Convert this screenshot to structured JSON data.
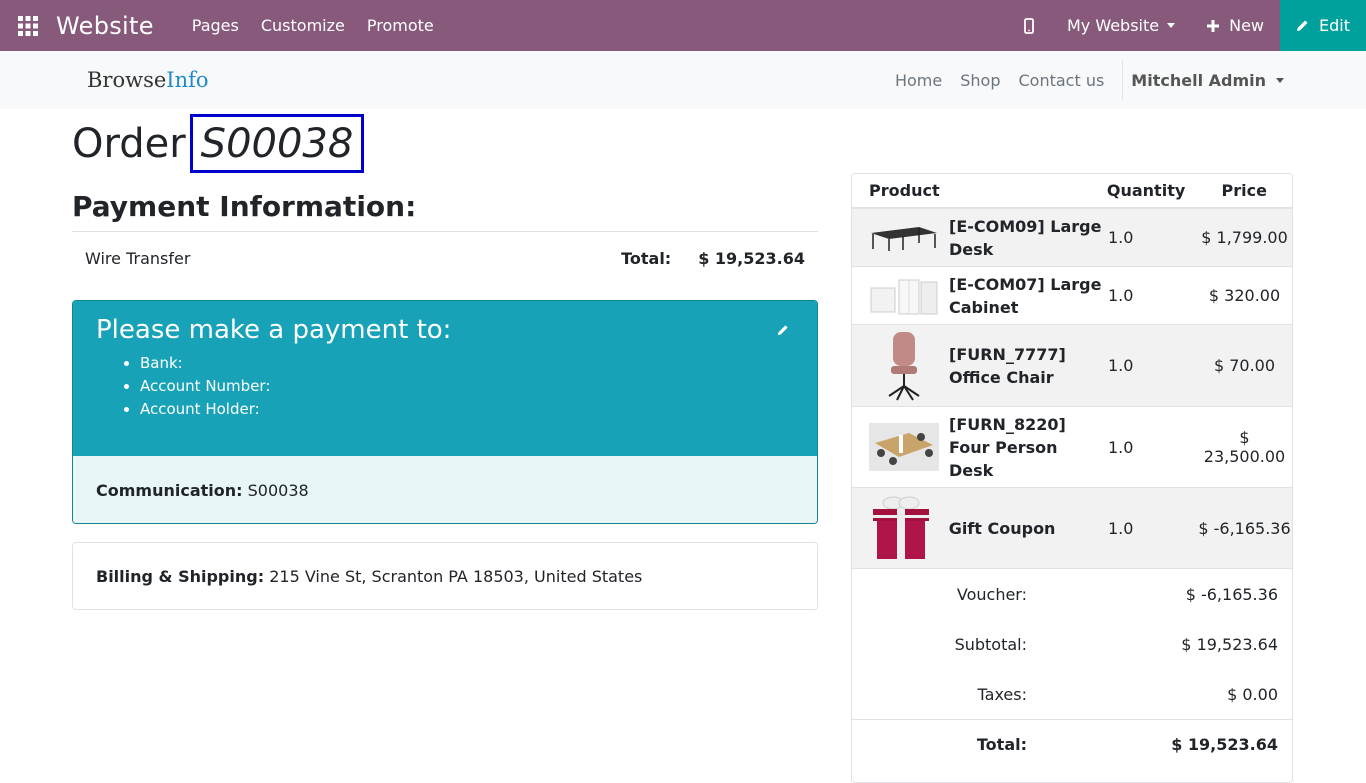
{
  "admin_bar": {
    "brand": "Website",
    "menu": [
      "Pages",
      "Customize",
      "Promote"
    ],
    "site_selector": "My Website",
    "new_label": "New",
    "edit_label": "Edit"
  },
  "site_header": {
    "logo_part1": "Browse",
    "logo_part2": "Info",
    "nav": [
      "Home",
      "Shop",
      "Contact us"
    ],
    "user": "Mitchell Admin"
  },
  "order": {
    "label": "Order",
    "number": "S00038"
  },
  "payment": {
    "heading": "Payment Information:",
    "method": "Wire Transfer",
    "total_label": "Total:",
    "total_value": "$ 19,523.64",
    "instructions_title": "Please make a payment to:",
    "instructions": [
      "Bank:",
      "Account Number:",
      "Account Holder:"
    ],
    "communication_label": "Communication:",
    "communication_value": "S00038"
  },
  "billing": {
    "label": "Billing & Shipping:",
    "address": "215 Vine St, Scranton PA 18503, United States"
  },
  "summary": {
    "headers": {
      "product": "Product",
      "quantity": "Quantity",
      "price": "Price"
    },
    "lines": [
      {
        "name": "[E-COM09] Large Desk",
        "qty": "1.0",
        "price": "$ 1,799.00",
        "icon": "desk"
      },
      {
        "name": "[E-COM07] Large Cabinet",
        "qty": "1.0",
        "price": "$ 320.00",
        "icon": "cabinet"
      },
      {
        "name": "[FURN_7777] Office Chair",
        "qty": "1.0",
        "price": "$ 70.00",
        "icon": "chair"
      },
      {
        "name": "[FURN_8220] Four Person Desk",
        "qty": "1.0",
        "price": "$ 23,500.00",
        "icon": "four-desk"
      },
      {
        "name": "Gift Coupon",
        "qty": "1.0",
        "price": "$ -6,165.36",
        "icon": "gift"
      }
    ],
    "totals": {
      "voucher_label": "Voucher:",
      "voucher_value": "$ -6,165.36",
      "subtotal_label": "Subtotal:",
      "subtotal_value": "$ 19,523.64",
      "taxes_label": "Taxes:",
      "taxes_value": "$ 0.00",
      "total_label": "Total:",
      "total_value": "$ 19,523.64"
    }
  },
  "colors": {
    "admin_bar": "#875a7b",
    "edit_button": "#00a09d",
    "payment_card": "#17a2b8",
    "highlight_border": "#0000cc"
  }
}
